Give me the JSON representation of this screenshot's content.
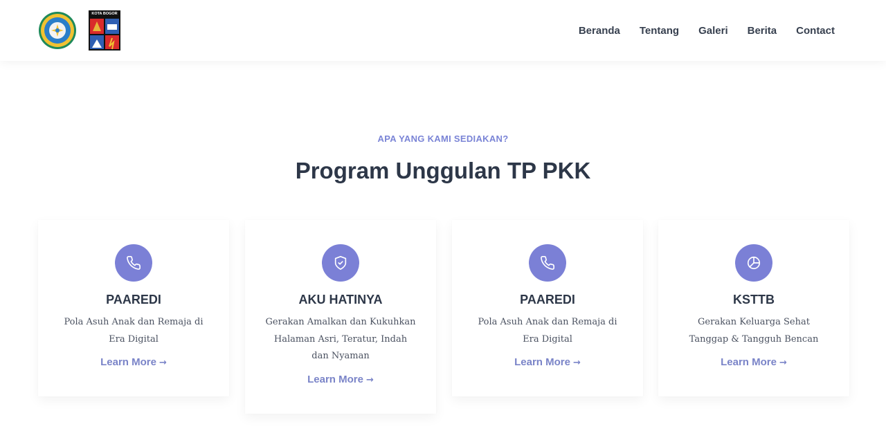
{
  "header": {
    "logo_bogor_text": "KOTA BOGOR",
    "nav": [
      {
        "label": "Beranda"
      },
      {
        "label": "Tentang"
      },
      {
        "label": "Galeri"
      },
      {
        "label": "Berita"
      },
      {
        "label": "Contact"
      }
    ]
  },
  "section": {
    "kicker": "APA YANG KAMI SEDIAKAN?",
    "title": "Program Unggulan TP PKK"
  },
  "cards": [
    {
      "icon": "phone-icon",
      "title": "PAAREDI",
      "description": "Pola Asuh Anak dan Remaja di Era Digital",
      "link": "Learn More"
    },
    {
      "icon": "shield-check-icon",
      "title": "AKU HATINYA",
      "description": "Gerakan Amalkan dan Kukuhkan Halaman Asri, Teratur, Indah dan Nyaman",
      "link": "Learn More"
    },
    {
      "icon": "phone-icon",
      "title": "PAAREDI",
      "description": "Pola Asuh Anak dan Remaja di Era Digital",
      "link": "Learn More"
    },
    {
      "icon": "pie-chart-icon",
      "title": "KSTTB",
      "description": "Gerakan Keluarga Sehat Tanggap & Tangguh Bencan",
      "link": "Learn More"
    }
  ],
  "colors": {
    "accent": "#7b80d6",
    "link": "#7a84c8",
    "heading": "#2d3748"
  }
}
